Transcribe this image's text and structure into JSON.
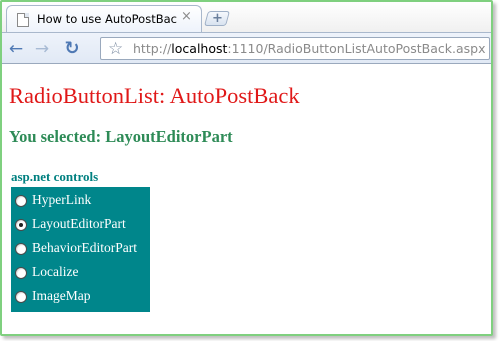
{
  "browser": {
    "tab_title": "How to use AutoPostBack f...",
    "tab_close": "×",
    "new_tab": "+",
    "url_scheme": "http://",
    "url_host": "localhost",
    "url_rest": ":1110/RadioButtonListAutoPostBack.aspx",
    "icons": {
      "back": "arrow-left-icon",
      "forward": "arrow-right-icon",
      "reload": "reload-icon",
      "bookmark": "star-icon",
      "page": "page-icon"
    }
  },
  "page": {
    "title": "RadioButtonList: AutoPostBack",
    "selected_message": "You selected: LayoutEditorPart",
    "list_label": "asp.net controls",
    "options": [
      {
        "label": "HyperLink",
        "checked": false
      },
      {
        "label": "LayoutEditorPart",
        "checked": true
      },
      {
        "label": "BehaviorEditorPart",
        "checked": false
      },
      {
        "label": "Localize",
        "checked": false
      },
      {
        "label": "ImageMap",
        "checked": false
      }
    ],
    "colors": {
      "title": "#e01818",
      "selected_message": "#2e8b57",
      "list_label": "#008080",
      "list_background": "#00868b",
      "frame_border": "#7fd07f"
    }
  }
}
